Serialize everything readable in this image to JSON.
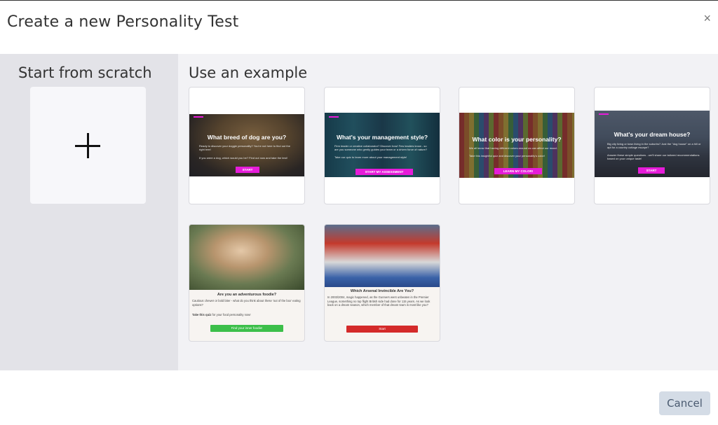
{
  "modal": {
    "title": "Create a new Personality Test",
    "close_label": "×"
  },
  "scratch": {
    "title": "Start from scratch"
  },
  "examples": {
    "title": "Use an example",
    "items": [
      {
        "heading": "What breed of dog are you?",
        "text1": "Ready to discover your doggie personality? You're not here to find out the right tree!",
        "text2": "If you were a dog, which would you be? Find out now and take the test!",
        "button": "START"
      },
      {
        "heading": "What's your management style?",
        "text1": "Firm leader or creative collaborator? Discover how! Few leaders know - so are you someone who gently guides your team or a driven force of nature?",
        "text2": "Take our quiz to learn more about your management style!",
        "button": "START MY ASSESSMENT"
      },
      {
        "heading": "What color is your personality?",
        "text1": "We all know that having different colors around us can affect our mood.",
        "text2": "Take this insightful quiz and discover your personality's color!",
        "button": "LEARN MY COLOR!"
      },
      {
        "heading": "What's your dream house?",
        "text1": "Big city living or town living in the suburbs? Just the \"dog house\" on a hill or apt for a country cottage escape?",
        "text2": "Answer these simple questions - we'll share our tailored recommendations based on your unique taste!",
        "button": "START"
      },
      {
        "heading": "Are you an adventurous foodie?",
        "text1": "Cautious chewer or bold biter - what do you think about these 'out of the box' eating options?",
        "text2_bold": "Take this quiz",
        "text2": " for your food personality now!",
        "button": "Find your inner foodie!",
        "button_color": "#3cbf4a"
      },
      {
        "heading": "Which Arsenal Invincible Are You?",
        "text1": "In 2003/2004, magic happened, as the Gunners went unbeaten in the Premier League, something no top flight British side had done for 115 years. As we look back on a dream season, which member of that dream team is most like you?",
        "button": "Start",
        "button_color": "#d42a2a"
      }
    ]
  },
  "footer": {
    "cancel_label": "Cancel"
  }
}
